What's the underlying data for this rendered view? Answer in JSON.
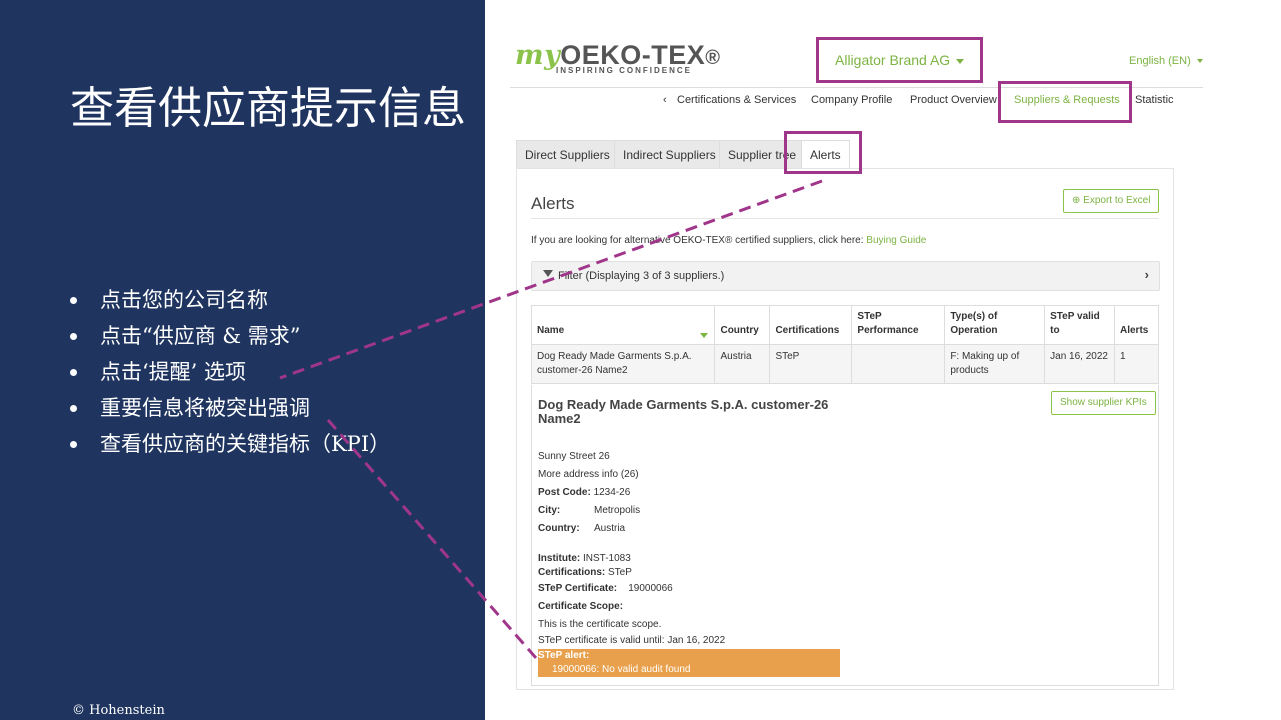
{
  "slide": {
    "title": "查看供应商提示信息",
    "bullets": [
      "点击您的公司名称",
      "点击“供应商 & 需求”",
      "点击‘提醒’ 选项",
      "重要信息将被突出强调",
      "查看供应商的关键指标（KPI）"
    ],
    "copyright": "© Hohenstein"
  },
  "app": {
    "logo": {
      "my": "my",
      "name": "OEKO-TEX",
      "reg": "®",
      "tagline": "INSPIRING CONFIDENCE"
    },
    "brand_select": "Alligator Brand AG",
    "language": "English (EN)",
    "nav": {
      "back": "‹",
      "items": [
        "Certifications & Services",
        "Company Profile",
        "Product Overview",
        "Suppliers & Requests",
        "Statistic"
      ]
    },
    "tabs": [
      "Direct Suppliers",
      "Indirect Suppliers",
      "Supplier tree",
      "Alerts"
    ],
    "alerts": {
      "heading": "Alerts",
      "export_button": "Export to Excel",
      "info_text": "If you are looking for alternative OEKO-TEX® certified suppliers, click here:",
      "info_link": "Buying Guide",
      "filter_text": "Filter (Displaying 3 of 3 suppliers.)",
      "table": {
        "headers": [
          "Name",
          "Country",
          "Certifications",
          "STeP Performance",
          "Type(s) of Operation",
          "STeP valid to",
          "Alerts"
        ],
        "rows": [
          [
            "Dog Ready Made Garments S.p.A. customer-26 Name2",
            "Austria",
            "STeP",
            "",
            "F: Making up of products",
            "Jan 16, 2022",
            "1"
          ]
        ]
      },
      "detail": {
        "title": "Dog Ready Made Garments S.p.A. customer-26 Name2",
        "kpi_button": "Show supplier KPIs",
        "street": "Sunny Street 26",
        "address_more": "More address info (26)",
        "post_code_label": "Post Code:",
        "post_code": "1234-26",
        "city_label": "City:",
        "city": "Metropolis",
        "country_label": "Country:",
        "country": "Austria",
        "institute_label": "Institute:",
        "institute": "INST-1083",
        "certifications_label": "Certifications:",
        "certifications": "STeP",
        "step_cert_label": "STeP Certificate:",
        "step_cert": "19000066",
        "scope_label": "Certificate Scope:",
        "scope_text": "This is the certificate scope.",
        "valid_until": "STeP certificate is valid until: Jan 16, 2022",
        "step_alert_title": "STeP alert:",
        "step_alert_msg": "19000066: No valid audit found"
      }
    }
  },
  "colors": {
    "navy": "#1f3560",
    "accent_green": "#7cb342",
    "highlight": "#a0368a",
    "alert_orange": "#e8a04c"
  }
}
